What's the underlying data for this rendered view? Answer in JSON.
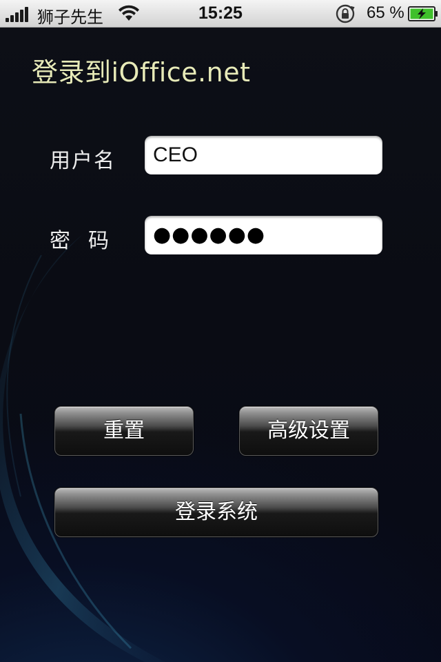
{
  "status_bar": {
    "carrier": "狮子先生",
    "time": "15:25",
    "battery_percent": "65 %",
    "signal_icon": "signal-bars-icon",
    "wifi_icon": "wifi-icon",
    "rotation_lock_icon": "rotation-lock-icon",
    "battery_icon": "battery-charging-icon"
  },
  "login": {
    "title": "登录到iOffice.net",
    "username_label": "用户名",
    "password_label": "密码",
    "username_value": "CEO",
    "password_masked": "●●●●●●"
  },
  "buttons": {
    "reset": "重置",
    "advanced": "高级设置",
    "login": "登录系统"
  },
  "colors": {
    "title": "#e7eab8",
    "background": "#0a0c14",
    "button_dark": "#0e0e0e",
    "button_light": "#b9b9b9",
    "battery_fill": "#3fc02b"
  }
}
